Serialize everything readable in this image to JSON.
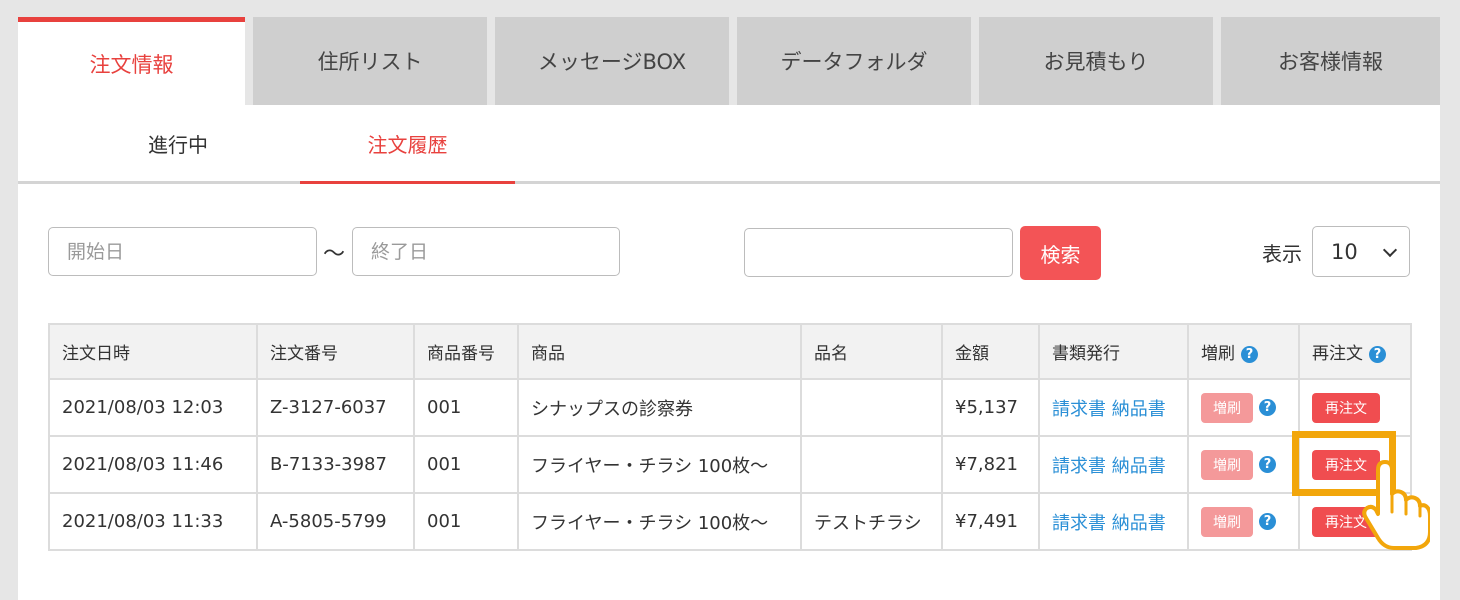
{
  "main_tabs": [
    {
      "label": "注文情報",
      "active": true
    },
    {
      "label": "住所リスト",
      "active": false
    },
    {
      "label": "メッセージBOX",
      "active": false
    },
    {
      "label": "データフォルダ",
      "active": false
    },
    {
      "label": "お見積もり",
      "active": false
    },
    {
      "label": "お客様情報",
      "active": false
    }
  ],
  "sub_tabs": [
    {
      "label": "進行中",
      "active": false
    },
    {
      "label": "注文履歴",
      "active": true
    }
  ],
  "filters": {
    "start_placeholder": "開始日",
    "separator": "〜",
    "end_placeholder": "終了日",
    "keyword_placeholder": "",
    "search_label": "検索",
    "display_label": "表示",
    "display_value": "10"
  },
  "table": {
    "headers": [
      "注文日時",
      "注文番号",
      "商品番号",
      "商品",
      "品名",
      "金額",
      "書類発行",
      "増刷",
      "再注文"
    ],
    "rows": [
      {
        "datetime": "2021/08/03 12:03",
        "order_no": "Z-3127-6037",
        "product_no": "001",
        "product": "シナップスの診察券",
        "name": "",
        "amount": "¥5,137",
        "invoice": "請求書",
        "delivery": "納品書",
        "reprint": "増刷",
        "reorder": "再注文"
      },
      {
        "datetime": "2021/08/03 11:46",
        "order_no": "B-7133-3987",
        "product_no": "001",
        "product": "フライヤー・チラシ 100枚〜",
        "name": "",
        "amount": "¥7,821",
        "invoice": "請求書",
        "delivery": "納品書",
        "reprint": "増刷",
        "reorder": "再注文"
      },
      {
        "datetime": "2021/08/03 11:33",
        "order_no": "A-5805-5799",
        "product_no": "001",
        "product": "フライヤー・チラシ 100枚〜",
        "name": "テストチラシ",
        "amount": "¥7,491",
        "invoice": "請求書",
        "delivery": "納品書",
        "reprint": "増刷",
        "reorder": "再注文"
      }
    ]
  },
  "colors": {
    "accent": "#e8413e",
    "link": "#2a8fd6",
    "highlight": "#f2a60b"
  },
  "icons": {
    "help": "question-circle-icon",
    "pointer": "hand-pointer-icon"
  }
}
